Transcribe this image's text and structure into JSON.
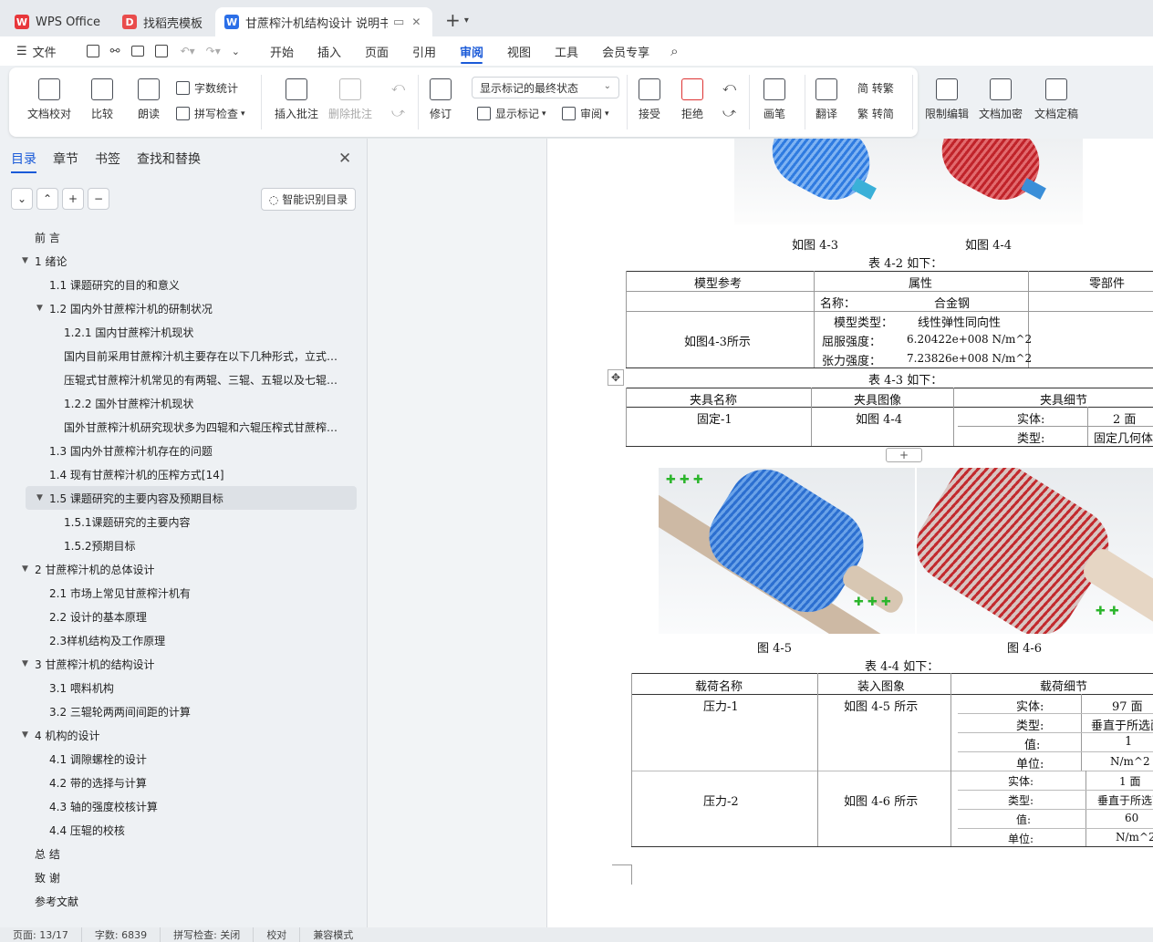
{
  "tabs": [
    {
      "label": "WPS Office",
      "icon": "wps-logo-icon"
    },
    {
      "label": "找稻壳模板",
      "icon": "docer-icon"
    },
    {
      "label": "甘蔗榨汁机结构设计 说明书（",
      "icon": "word-doc-icon"
    }
  ],
  "menu": {
    "file": "文件",
    "items": [
      "开始",
      "插入",
      "页面",
      "引用",
      "审阅",
      "视图",
      "工具",
      "会员专享"
    ],
    "active": "审阅"
  },
  "ribbon": {
    "doc_check": "文档校对",
    "compare": "比较",
    "read_aloud": "朗读",
    "word_count": "字数统计",
    "spell_check": "拼写检查",
    "insert_comment": "插入批注",
    "delete_comment": "删除批注",
    "track": "修订",
    "markup_state": "显示标记的最终状态",
    "show_markup": "显示标记",
    "review": "审阅",
    "accept": "接受",
    "reject": "拒绝",
    "pen": "画笔",
    "translate": "翻译",
    "to_trad": "简 转繁",
    "to_simp": "繁 转简",
    "restrict_edit": "限制编辑",
    "encrypt": "文档加密",
    "finalize": "文档定稿"
  },
  "sidebar": {
    "tabs": [
      "目录",
      "章节",
      "书签",
      "查找和替换"
    ],
    "smart_toc": "智能识别目录",
    "toc": [
      {
        "text": "前 言",
        "level": 1,
        "tw": ""
      },
      {
        "text": "1 绪论",
        "level": 1,
        "tw": "▼"
      },
      {
        "text": "1.1 课题研究的目的和意义",
        "level": 2,
        "tw": ""
      },
      {
        "text": "1.2 国内外甘蔗榨汁机的研制状况",
        "level": 2,
        "tw": "▼"
      },
      {
        "text": "1.2.1 国内甘蔗榨汁机现状",
        "level": 3,
        "tw": ""
      },
      {
        "text": "国内目前采用甘蔗榨汁机主要存在以下几种形式，立式…",
        "level": 3,
        "tw": ""
      },
      {
        "text": "压辊式甘蔗榨汁机常见的有两辊、三辊、五辊以及七辊…",
        "level": 3,
        "tw": ""
      },
      {
        "text": "1.2.2  国外甘蔗榨汁机现状",
        "level": 3,
        "tw": ""
      },
      {
        "text": "国外甘蔗榨汁机研究现状多为四辊和六辊压榨式甘蔗榨…",
        "level": 3,
        "tw": ""
      },
      {
        "text": "1.3 国内外甘蔗榨汁机存在的问题",
        "level": 2,
        "tw": ""
      },
      {
        "text": "1.4 现有甘蔗榨汁机的压榨方式[14]",
        "level": 2,
        "tw": ""
      },
      {
        "text": "1.5 课题研究的主要内容及预期目标",
        "level": 2,
        "tw": "▼",
        "sel": true
      },
      {
        "text": "1.5.1课题研究的主要内容",
        "level": 3,
        "tw": ""
      },
      {
        "text": "1.5.2预期目标",
        "level": 3,
        "tw": ""
      },
      {
        "text": "2 甘蔗榨汁机的总体设计",
        "level": 1,
        "tw": "▼"
      },
      {
        "text": "2.1 市场上常见甘蔗榨汁机有",
        "level": 2,
        "tw": ""
      },
      {
        "text": "2.2 设计的基本原理",
        "level": 2,
        "tw": ""
      },
      {
        "text": "2.3样机结构及工作原理",
        "level": 2,
        "tw": ""
      },
      {
        "text": "3 甘蔗榨汁机的结构设计",
        "level": 1,
        "tw": "▼"
      },
      {
        "text": "3.1 喂料机构",
        "level": 2,
        "tw": ""
      },
      {
        "text": "3.2 三辊轮两两间间距的计算",
        "level": 2,
        "tw": ""
      },
      {
        "text": "4 机构的设计",
        "level": 1,
        "tw": "▼"
      },
      {
        "text": "4.1 调隙螺栓的设计",
        "level": 2,
        "tw": ""
      },
      {
        "text": "4.2 带的选择与计算",
        "level": 2,
        "tw": ""
      },
      {
        "text": "4.3 轴的强度校核计算",
        "level": 2,
        "tw": ""
      },
      {
        "text": "4.4 压辊的校核",
        "level": 2,
        "tw": ""
      },
      {
        "text": "总 结",
        "level": 1,
        "tw": ""
      },
      {
        "text": "致 谢",
        "level": 1,
        "tw": ""
      },
      {
        "text": "参考文献",
        "level": 1,
        "tw": ""
      }
    ]
  },
  "doc": {
    "cap_43": "如图 4-3",
    "cap_44": "如图 4-4",
    "t42_title": "表 4-2 如下：",
    "t42_h": [
      "模型参考",
      "属性",
      "零部件"
    ],
    "t42_name_k": "名称：",
    "t42_name_v": "合金钢",
    "t42_ref": "如图4-3所示",
    "t42_type_k": "模型类型：",
    "t42_type_v": "线性弹性同向性",
    "t42_yield_k": "屈服强度：",
    "t42_yield_v": "6.20422e+008 N/m^2",
    "t42_tensile_k": "张力强度：",
    "t42_tensile_v": "7.23826e+008 N/m^2",
    "t43_title": "表 4-3 如下：",
    "t43_h": [
      "夹具名称",
      "夹具图像",
      "夹具细节"
    ],
    "t43_name": "固定-1",
    "t43_img": "如图 4-4",
    "t43_ent_k": "实体:",
    "t43_ent_v": "2  面",
    "t43_type_k": "类型:",
    "t43_type_v": "固定几何体",
    "add_row": "+",
    "cap_45": "图 4-5",
    "cap_46": "图 4-6",
    "t44_title": "表 4-4 如下：",
    "t44_h": [
      "载荷名称",
      "装入图象",
      "载荷细节"
    ],
    "p1_name": "压力-1",
    "p1_img": "如图 4-5 所示",
    "p1_ent_k": "实体:",
    "p1_ent_v": "97  面",
    "p1_type_k": "类型:",
    "p1_type_v": "垂直于所选面",
    "p1_val_k": "值:",
    "p1_val_v": "1",
    "p1_unit_k": "单位:",
    "p1_unit_v": "N/m^2",
    "p2_name": "压力-2",
    "p2_img": "如图 4-6 所示",
    "p2_ent_k": "实体:",
    "p2_ent_v": "1  面",
    "p2_type_k": "类型:",
    "p2_type_v": "垂直于所选面",
    "p2_val_k": "值:",
    "p2_val_v": "60",
    "p2_unit_k": "单位:",
    "p2_unit_v": "N/m^2"
  },
  "status": {
    "page": "页面: 13/17",
    "words": "字数: 6839",
    "spell": "拼写检查: 关闭",
    "proof": "校对",
    "compat": "兼容模式"
  }
}
